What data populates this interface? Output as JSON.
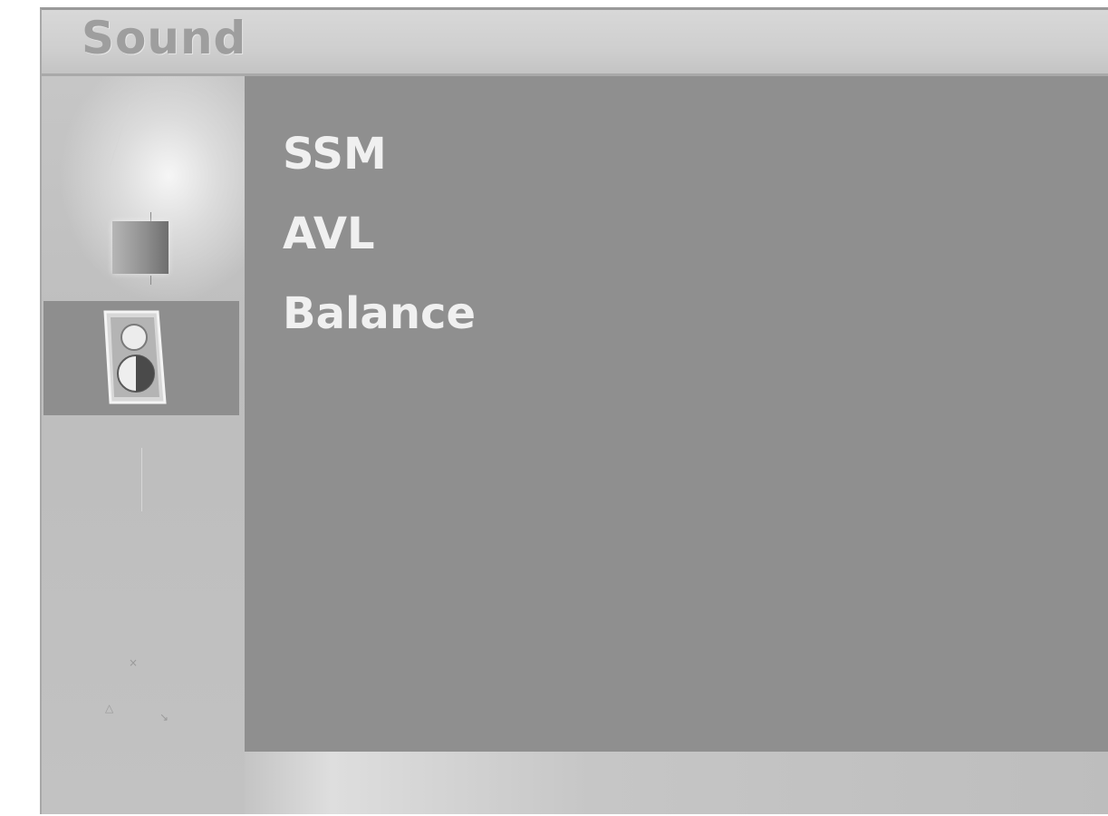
{
  "title_bar": {
    "title": "Sound"
  },
  "sidebar": {
    "items": [
      {
        "name": "picture",
        "icon": "picture-icon",
        "selected": false
      },
      {
        "name": "sound",
        "icon": "speaker-icon",
        "selected": true
      }
    ]
  },
  "menu": {
    "items": [
      {
        "label": "SSM"
      },
      {
        "label": "AVL"
      },
      {
        "label": "Balance"
      }
    ]
  },
  "colors": {
    "panel": "#8f8f8f",
    "selected_row": "#8e8e8e",
    "menu_text": "#f0f0f0",
    "title_text": "#9e9e9e"
  }
}
